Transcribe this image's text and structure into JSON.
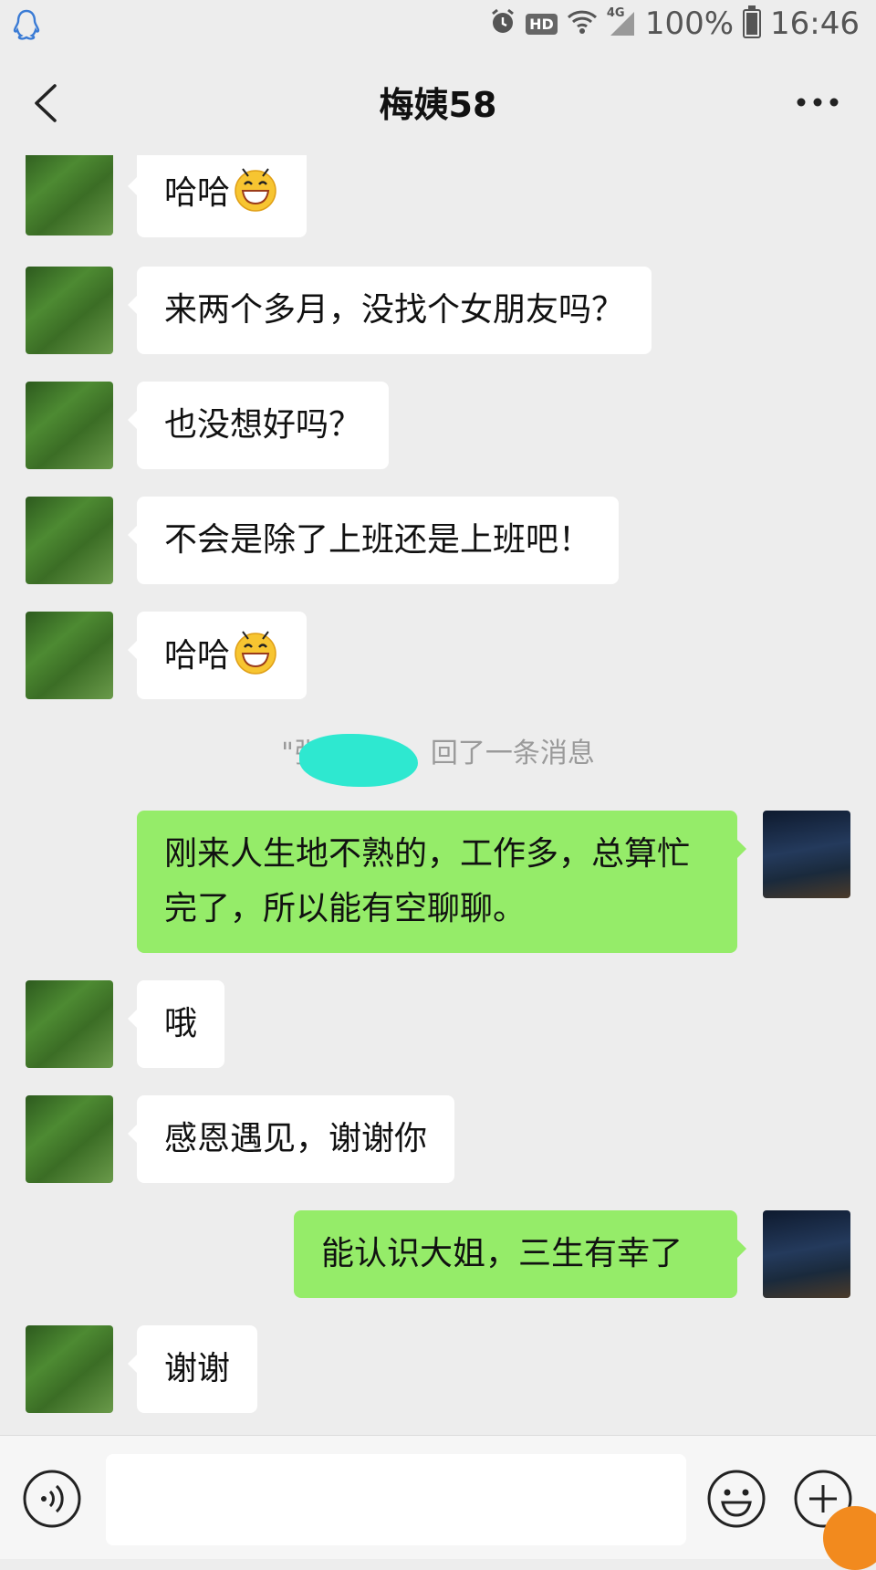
{
  "status_bar": {
    "left_icon": "qq-penguin-icon",
    "icons": [
      "alarm-icon",
      "hd-icon",
      "wifi-icon",
      "signal-4g-icon"
    ],
    "hd_label": "HD",
    "network_label": "4G",
    "battery": "100%",
    "time": "16:46"
  },
  "header": {
    "back_icon": "chevron-left-icon",
    "title": "梅姨58",
    "more_icon": "more-dots-icon"
  },
  "messages": [
    {
      "side": "left",
      "text": "哈哈",
      "emoji": "grinning-face-emoji"
    },
    {
      "side": "left",
      "text": "来两个多月，没找个女朋友吗？"
    },
    {
      "side": "left",
      "text": "也没想好吗？"
    },
    {
      "side": "left",
      "text": "不会是除了上班还是上班吧！"
    },
    {
      "side": "left",
      "text": "哈哈",
      "emoji": "grinning-face-emoji"
    },
    {
      "side": "system",
      "text": "\"张",
      "text_after": "回了一条消息"
    },
    {
      "side": "right",
      "text": "刚来人生地不熟的，工作多，总算忙完了，所以能有空聊聊。"
    },
    {
      "side": "left",
      "text": "哦"
    },
    {
      "side": "left",
      "text": "感恩遇见，谢谢你"
    },
    {
      "side": "right",
      "text": "能认识大姐，三生有幸了"
    },
    {
      "side": "left",
      "text": "谢谢"
    }
  ],
  "input_bar": {
    "voice_icon": "voice-icon",
    "input_value": "",
    "emoji_icon": "emoji-icon",
    "plus_icon": "plus-circle-icon"
  },
  "colors": {
    "background": "#ededed",
    "incoming_bubble": "#ffffff",
    "outgoing_bubble": "#95ec69",
    "system_text": "#9a9a9a"
  }
}
